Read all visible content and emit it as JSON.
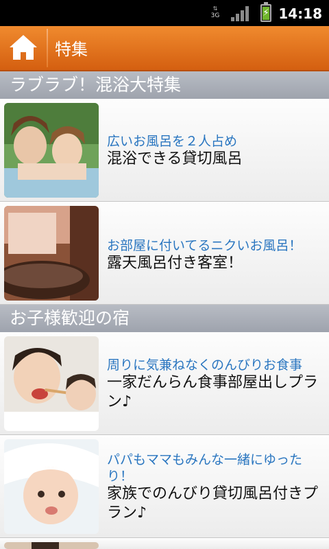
{
  "status_bar": {
    "network": "3G",
    "time": "14:18"
  },
  "title_bar": {
    "title": "特集"
  },
  "sections": [
    {
      "header": "ラブラブ！混浴大特集",
      "items": [
        {
          "catch": "広いお風呂を２人占め",
          "title": "混浴できる貸切風呂"
        },
        {
          "catch": "お部屋に付いてるニクいお風呂！",
          "title": "露天風呂付き客室！"
        }
      ]
    },
    {
      "header": "お子様歓迎の宿",
      "items": [
        {
          "catch": "周りに気兼ねなくのんびりお食事",
          "title": "一家だんらん食事部屋出しプラン♪"
        },
        {
          "catch": "パパもママもみんな一緒にゆったり！",
          "title": "家族でのんびり貸切風呂付きプラン♪"
        }
      ]
    }
  ],
  "colors": {
    "title_bar": "#e36f1c",
    "section_header": "#a9adb6",
    "catch_text": "#2a76c0"
  }
}
